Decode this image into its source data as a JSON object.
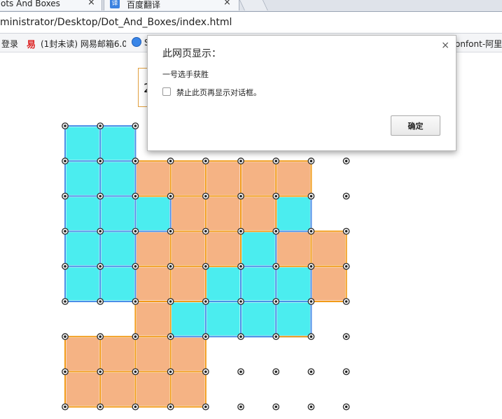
{
  "browser": {
    "tabs": [
      {
        "label": "ots And Boxes",
        "close": "×"
      },
      {
        "label": "百度翻译",
        "close": "×",
        "icon": "baidu-translate-icon"
      }
    ],
    "url": "ministrator/Desktop/Dot_And_Boxes/index.html",
    "bookmarks": {
      "login": "登录",
      "netease_icon": "易",
      "netease": "(1封未读) 网易邮箱6.0",
      "globe_label": "S",
      "iconfont": "onfont-阿里"
    }
  },
  "page": {
    "score": "2"
  },
  "colors": {
    "player1": "#4bedef",
    "player2": "#f5b384",
    "line_blue": "#4a8fe8",
    "line_orange": "#f29b18"
  },
  "board": {
    "rows": 8,
    "cols": 8,
    "boxes": [
      "11......",
      "1122222.",
      "1112221.",
      "11222122",
      "11221112",
      "..21111.",
      "2222....",
      "2222...."
    ],
    "extra_lines": [
      {
        "row": 6,
        "col": 5,
        "color": "blue"
      },
      {
        "row": 6,
        "col": 6,
        "color": "orange"
      }
    ]
  },
  "dialog": {
    "title": "此网页显示：",
    "close": "×",
    "message": "一号选手获胜",
    "checkbox_label": "禁止此页再显示对话框。",
    "ok_label": "确定"
  }
}
